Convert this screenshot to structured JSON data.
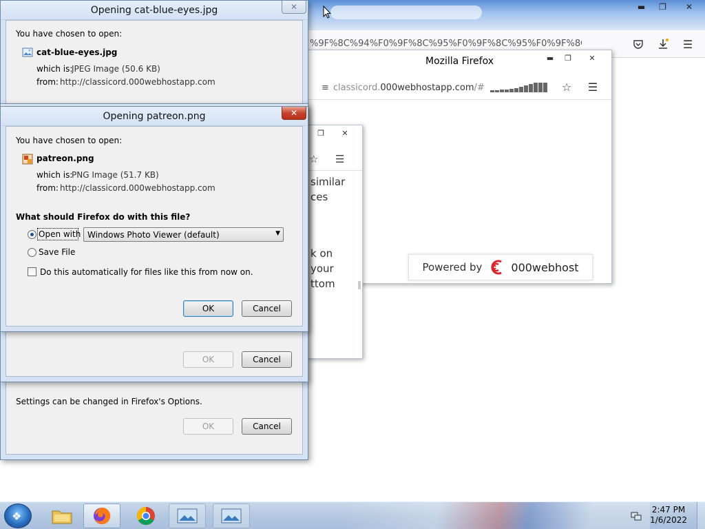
{
  "background_firefox": {
    "url_tail": "%9F%8C%94%F0%9F%8C%95%F0%9F%8C%95%F0%9F%8C%9",
    "icons": [
      "pocket-icon",
      "download-icon",
      "menu-icon"
    ]
  },
  "firefox_window2": {
    "title": "Mozilla Firefox",
    "url_prefix": "classicord.",
    "url_host": "000webhostapp.com",
    "url_suffix": "/#",
    "powered_label": "Powered by",
    "powered_brand": "000webhost"
  },
  "firefox_window3": {
    "text_lines": [
      "similar",
      "ces",
      "k on",
      "your",
      "ttom"
    ]
  },
  "dialog_back": {
    "title": "Opening cat-blue-eyes.jpg",
    "chosen_label": "You have chosen to open:",
    "filename": "cat-blue-eyes.jpg",
    "which_is_label": "which is:",
    "which_is_value": "JPEG Image (50.6 KB)",
    "from_label": "from:",
    "from_value": "http://classicord.000webhostapp.com",
    "settings_text": "Settings can be changed in Firefox's Options.",
    "ok_label": "OK",
    "cancel_label": "Cancel"
  },
  "dialog_middle": {
    "ok_label": "OK",
    "cancel_label": "Cancel"
  },
  "dialog_front": {
    "title": "Opening patreon.png",
    "chosen_label": "You have chosen to open:",
    "filename": "patreon.png",
    "which_is_label": "which is:",
    "which_is_value": "PNG Image (51.7 KB)",
    "from_label": "from:",
    "from_value": "http://classicord.000webhostapp.com",
    "question": "What should Firefox do with this file?",
    "open_with_label": "Open with",
    "open_with_selected": "Windows Photo Viewer (default)",
    "save_file_label": "Save File",
    "auto_label": "Do this automatically for files like this from now on.",
    "ok_label": "OK",
    "cancel_label": "Cancel"
  },
  "taskbar": {
    "time": "2:47 PM",
    "date": "1/6/2022"
  },
  "colors": {
    "close_red": "#c7452c",
    "dialog_bg": "#f0f0f0",
    "frame_blue": "#d4e2f4",
    "taskbar": "#b4c8e0"
  }
}
